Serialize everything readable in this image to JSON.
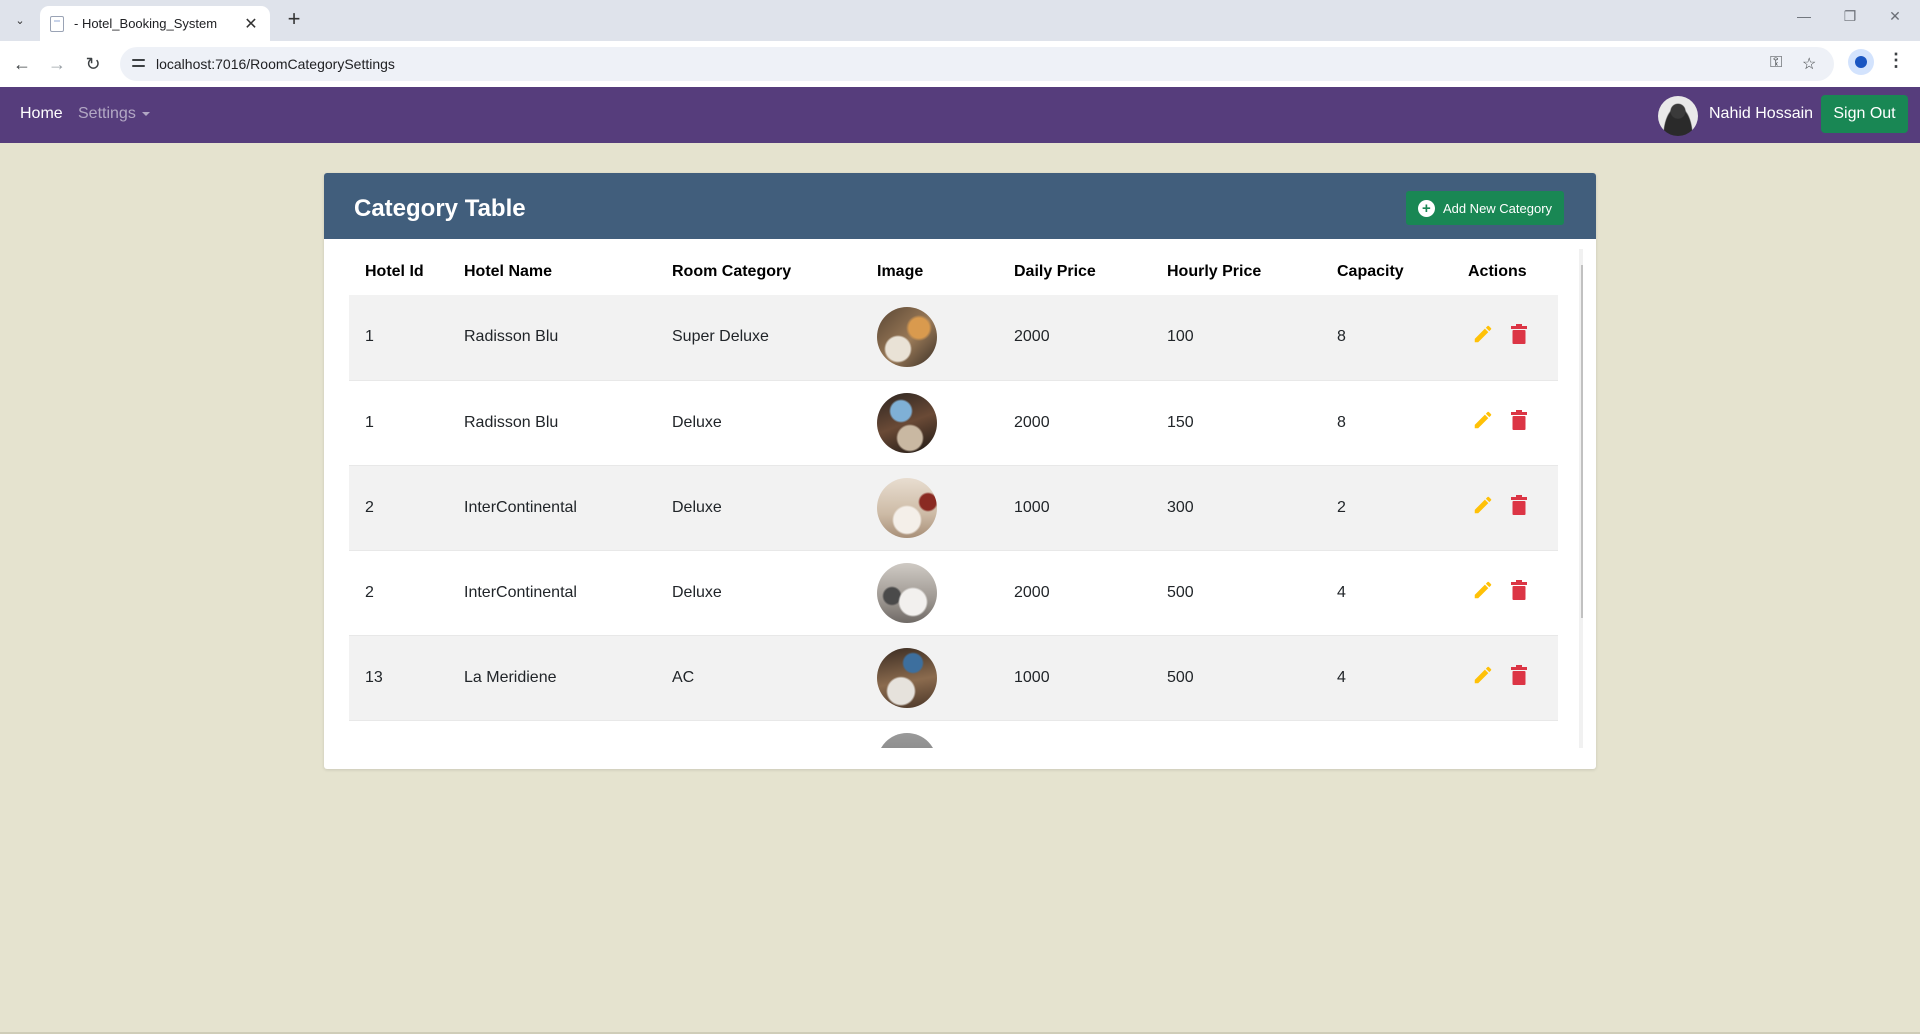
{
  "browser": {
    "tab_title": "- Hotel_Booking_System",
    "url": "localhost:7016/RoomCategorySettings",
    "tab_search_glyph": "⌄",
    "close_glyph": "✕",
    "new_tab_glyph": "+",
    "back_glyph": "←",
    "forward_glyph": "→",
    "reload_glyph": "↻",
    "minimize_glyph": "—",
    "maximize_glyph": "❐",
    "window_close_glyph": "✕",
    "menu_glyph": "⋮",
    "star_glyph": "☆",
    "key_glyph": "⚿"
  },
  "navbar": {
    "home_label": "Home",
    "settings_label": "Settings",
    "user_name": "Nahid Hossain",
    "signout_label": "Sign Out"
  },
  "card": {
    "title": "Category Table",
    "add_button_label": "Add New Category",
    "plus_glyph": "+"
  },
  "table": {
    "columns": [
      "Hotel Id",
      "Hotel Name",
      "Room Category",
      "Image",
      "Daily Price",
      "Hourly Price",
      "Capacity",
      "Actions"
    ],
    "rows": [
      {
        "hotel_id": "1",
        "hotel_name": "Radisson Blu",
        "room_category": "Super Deluxe",
        "daily_price": "2000",
        "hourly_price": "100",
        "capacity": "8"
      },
      {
        "hotel_id": "1",
        "hotel_name": "Radisson Blu",
        "room_category": "Deluxe",
        "daily_price": "2000",
        "hourly_price": "150",
        "capacity": "8"
      },
      {
        "hotel_id": "2",
        "hotel_name": "InterContinental",
        "room_category": "Deluxe",
        "daily_price": "1000",
        "hourly_price": "300",
        "capacity": "2"
      },
      {
        "hotel_id": "2",
        "hotel_name": "InterContinental",
        "room_category": "Deluxe",
        "daily_price": "2000",
        "hourly_price": "500",
        "capacity": "4"
      },
      {
        "hotel_id": "13",
        "hotel_name": "La Meridiene",
        "room_category": "AC",
        "daily_price": "1000",
        "hourly_price": "500",
        "capacity": "4"
      }
    ]
  },
  "colors": {
    "navbar": "#563d7c",
    "card_header": "#415e7c",
    "button_green": "#198754",
    "edit_icon": "#ffc107",
    "delete_icon": "#dc3545",
    "page_background": "#e5e3cf"
  }
}
